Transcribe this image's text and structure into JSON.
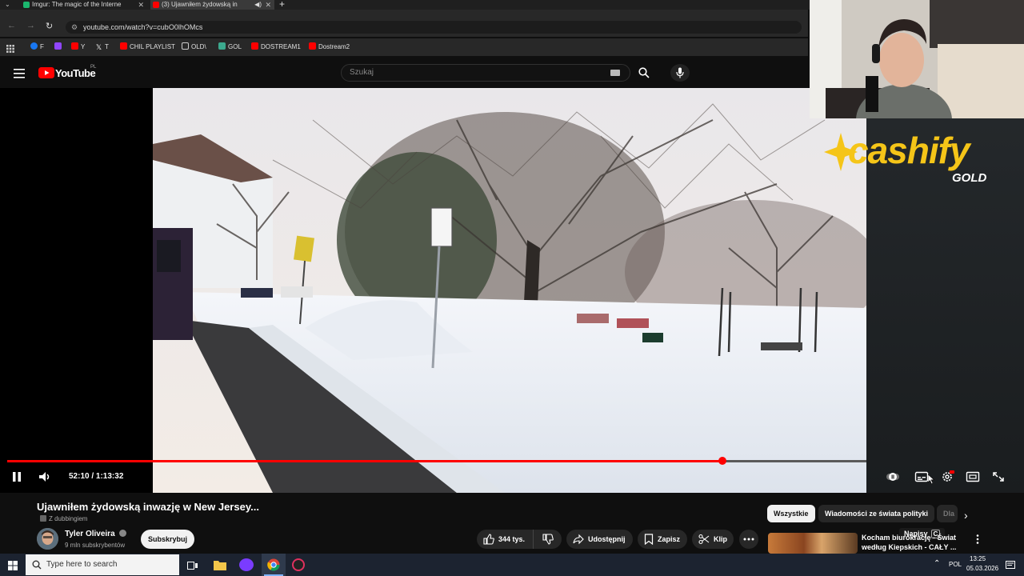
{
  "browser": {
    "tabs": [
      {
        "title": "Imgur: The magic of the Interne",
        "active": false
      },
      {
        "title": "(3) Ujawniłem żydowską in",
        "active": true
      }
    ],
    "url": "youtube.com/watch?v=cubO0lhOMcs",
    "bookmarks": [
      {
        "label": "F",
        "color": "#1877f2"
      },
      {
        "label": "",
        "color": "#9146ff"
      },
      {
        "label": "Y",
        "color": "#ff0000"
      },
      {
        "label": "T",
        "color": "#ffffff"
      },
      {
        "label": "CHIL PLAYLIST",
        "color": "#ff0000"
      },
      {
        "label": "OLD\\",
        "color": "#e8e8e8"
      },
      {
        "label": "GOL",
        "color": "#3ca98e"
      },
      {
        "label": "DOSTREAM1",
        "color": "#ff0000"
      },
      {
        "label": "Dostream2",
        "color": "#ff0000"
      }
    ]
  },
  "youtube": {
    "logo": "YouTube",
    "country": "PL",
    "search_placeholder": "Szukaj"
  },
  "player": {
    "time_current": "52:10",
    "time_total": "1:13:32",
    "time_display": "52:10 / 1:13:32",
    "progress_fraction": 0.832,
    "tooltip_label": "Napisy",
    "tooltip_key": "C",
    "playing": true
  },
  "video": {
    "title": "Ujawniłem żydowską inwazję w New Jersey...",
    "dubbing": "Z dubbingiem",
    "channel": "Tyler Oliveira",
    "subscribers": "9 mln subskrybentów",
    "subscribe_label": "Subskrybuj",
    "likes": "344 tys.",
    "share_label": "Udostępnij",
    "save_label": "Zapisz",
    "clip_label": "Klip"
  },
  "sidebar": {
    "chips": [
      "Wszystkie",
      "Wiadomości ze świata polityki",
      "Dla"
    ],
    "recommendation_title": "Kocham biurokrację - Świat według Kiepskich - CAŁY ..."
  },
  "overlay": {
    "brand_word": "cashify",
    "brand_sub": "GOLD"
  },
  "taskbar": {
    "search_placeholder": "Type here to search",
    "language": "POL",
    "time": "13:25",
    "date": "05.03.2026"
  },
  "colors": {
    "youtube_red": "#ff0000",
    "progress_red": "#ff0033",
    "brand_gold": "#f5c518"
  }
}
